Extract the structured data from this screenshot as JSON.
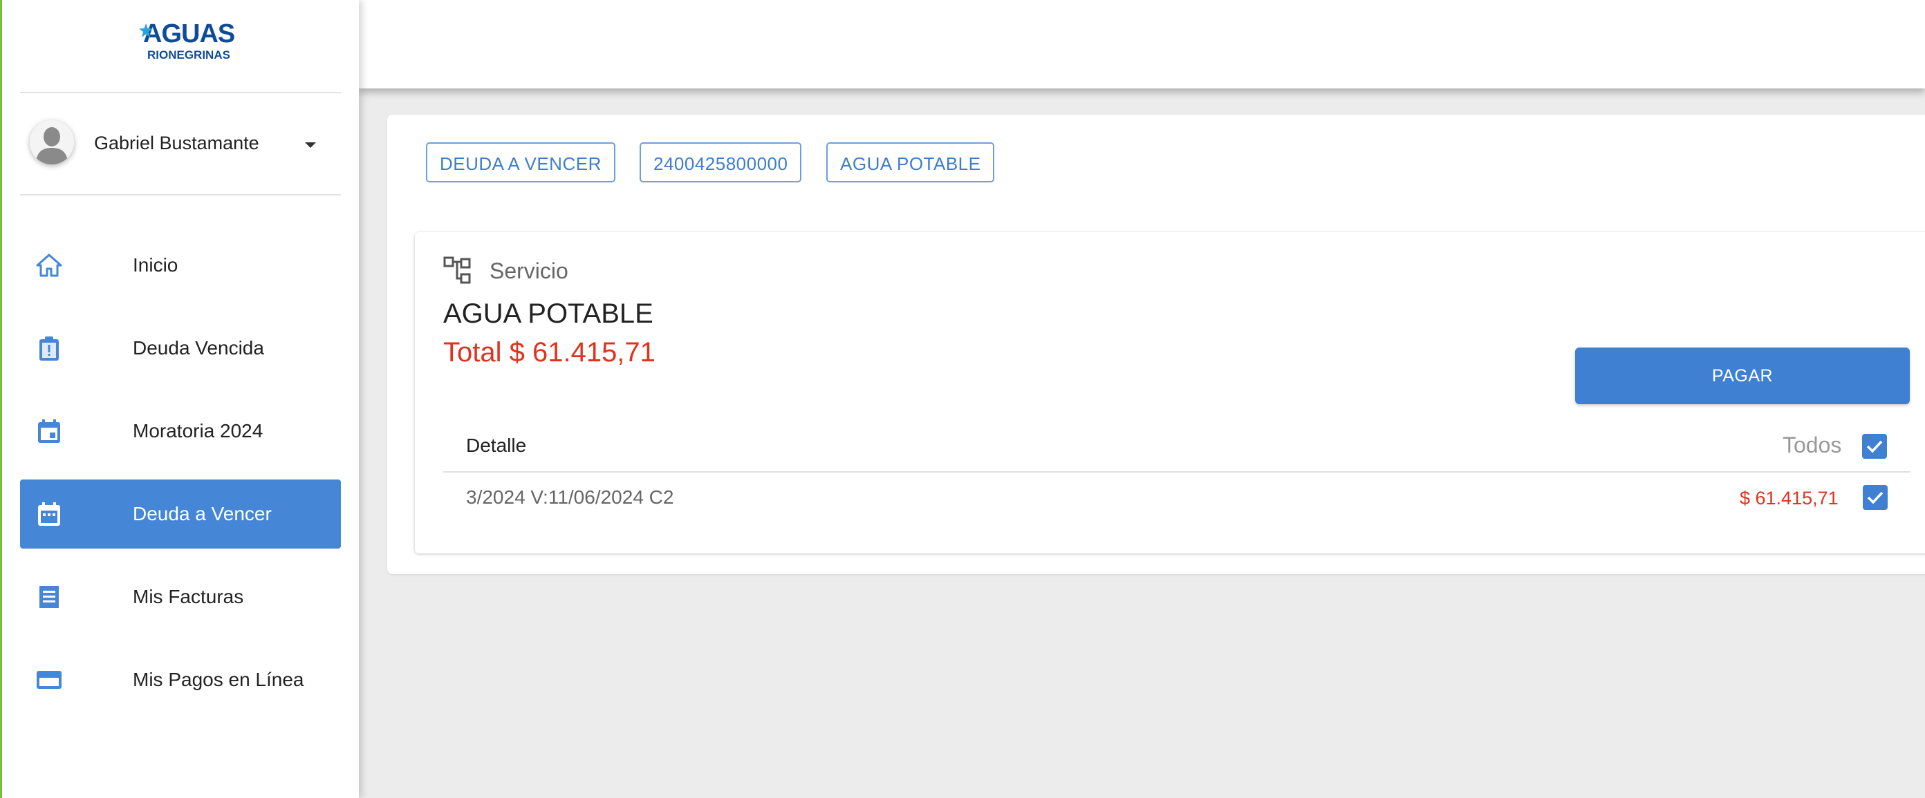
{
  "brand": {
    "logo_line1": "AGUAS",
    "logo_line2": "RIONEGRINAS",
    "colors": {
      "primary": "#4686d6",
      "accent_bar": "#7dc242",
      "amount": "#e0321d",
      "logo": "#0f4c97"
    }
  },
  "user": {
    "name": "Gabriel Bustamante"
  },
  "sidebar": {
    "items": [
      {
        "label": "Inicio",
        "icon": "home-icon",
        "active": false
      },
      {
        "label": "Deuda Vencida",
        "icon": "clipboard-alert-icon",
        "active": false
      },
      {
        "label": "Moratoria 2024",
        "icon": "calendar-icon",
        "active": false
      },
      {
        "label": "Deuda a Vencer",
        "icon": "calendar-dots-icon",
        "active": true
      },
      {
        "label": "Mis Facturas",
        "icon": "receipt-icon",
        "active": false
      },
      {
        "label": "Mis Pagos en Línea",
        "icon": "credit-card-icon",
        "active": false
      }
    ]
  },
  "main": {
    "chips": [
      "DEUDA A VENCER",
      "2400425800000",
      "AGUA POTABLE"
    ],
    "card": {
      "section_label": "Servicio",
      "service_name": "AGUA POTABLE",
      "total": "Total $ 61.415,71",
      "pay_button": "PAGAR",
      "table": {
        "header_detail": "Detalle",
        "header_all": "Todos",
        "all_checked": true,
        "rows": [
          {
            "detail": "3/2024 V:11/06/2024 C2",
            "amount": "$ 61.415,71",
            "checked": true
          }
        ]
      }
    }
  }
}
